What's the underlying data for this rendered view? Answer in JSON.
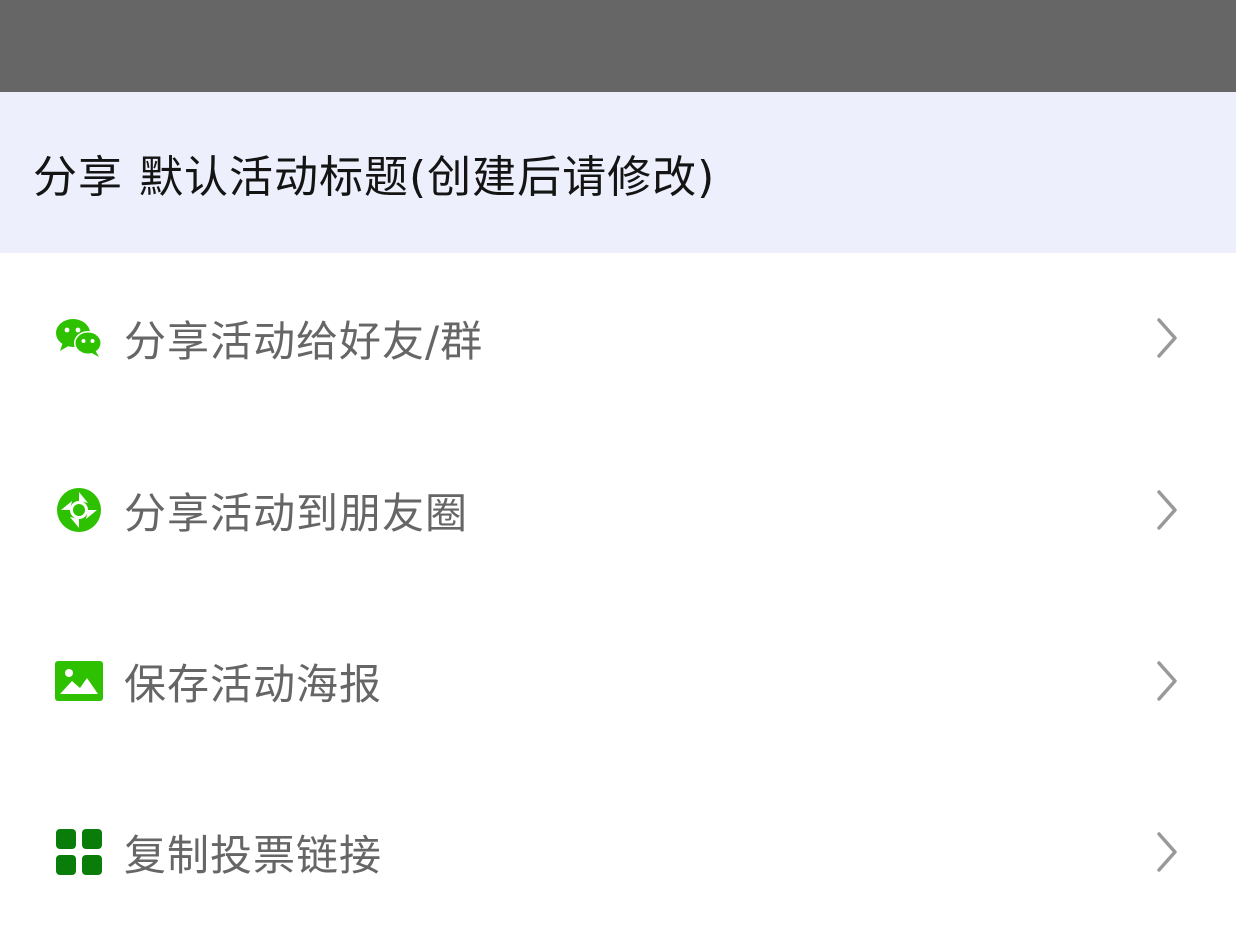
{
  "sheet": {
    "title_prefix": "分享",
    "title": "默认活动标题(创建后请修改)"
  },
  "menu": {
    "items": [
      {
        "label": "分享活动给好友/群",
        "icon": "wechat-icon"
      },
      {
        "label": "分享活动到朋友圈",
        "icon": "moments-icon"
      },
      {
        "label": "保存活动海报",
        "icon": "image-icon"
      },
      {
        "label": "复制投票链接",
        "icon": "grid-icon"
      }
    ]
  },
  "colors": {
    "overlay": "#666666",
    "header_bg": "#edeffc",
    "icon_green": "#2dc100",
    "icon_dark_green": "#0a7c0a",
    "label_gray": "#666666",
    "chevron_gray": "#999999"
  }
}
